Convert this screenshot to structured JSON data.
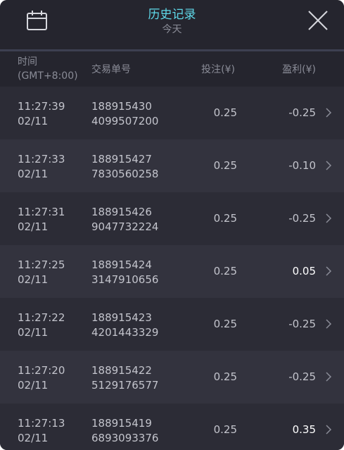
{
  "header": {
    "title": "历史记录",
    "subtitle": "今天",
    "calendar_icon": "calendar-icon",
    "close_icon": "close-icon",
    "title_color": "#5fd9e9"
  },
  "columns": {
    "time_line1": "时间",
    "time_line2": "(GMT+8:00)",
    "order": "交易单号",
    "bet": "投注(¥)",
    "profit": "盈利(¥)"
  },
  "rows": [
    {
      "time": "11:27:39",
      "date": "02/11",
      "order1": "188915430",
      "order2": "4099507200",
      "bet": "0.25",
      "profit": "-0.25",
      "positive": false
    },
    {
      "time": "11:27:33",
      "date": "02/11",
      "order1": "188915427",
      "order2": "7830560258",
      "bet": "0.25",
      "profit": "-0.10",
      "positive": false
    },
    {
      "time": "11:27:31",
      "date": "02/11",
      "order1": "188915426",
      "order2": "9047732224",
      "bet": "0.25",
      "profit": "-0.25",
      "positive": false
    },
    {
      "time": "11:27:25",
      "date": "02/11",
      "order1": "188915424",
      "order2": "3147910656",
      "bet": "0.25",
      "profit": "0.05",
      "positive": true
    },
    {
      "time": "11:27:22",
      "date": "02/11",
      "order1": "188915423",
      "order2": "4201443329",
      "bet": "0.25",
      "profit": "-0.25",
      "positive": false
    },
    {
      "time": "11:27:20",
      "date": "02/11",
      "order1": "188915422",
      "order2": "5129176577",
      "bet": "0.25",
      "profit": "-0.25",
      "positive": false
    },
    {
      "time": "11:27:13",
      "date": "02/11",
      "order1": "188915419",
      "order2": "6893093376",
      "bet": "0.25",
      "profit": "0.35",
      "positive": true
    }
  ]
}
